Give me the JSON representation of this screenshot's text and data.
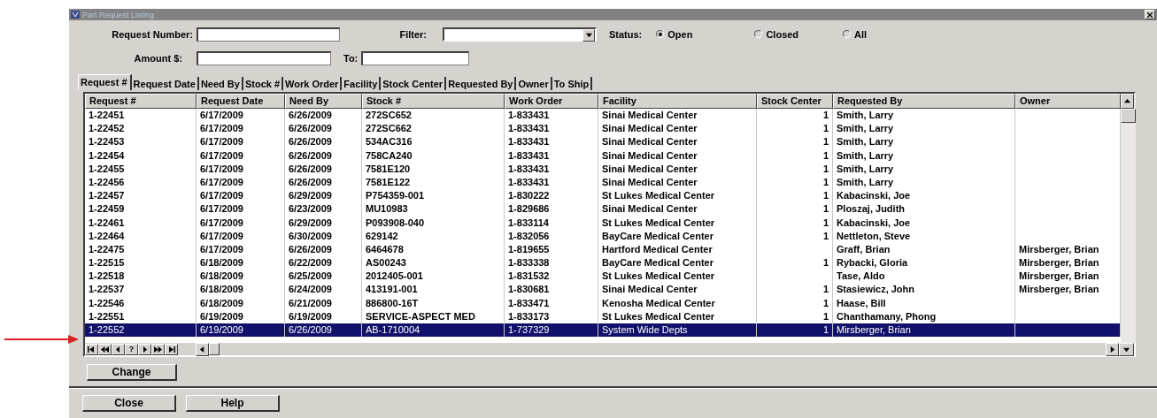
{
  "window": {
    "title": "Part Request Listing"
  },
  "filters": {
    "request_number_label": "Request Number:",
    "filter_label": "Filter:",
    "status_label": "Status:",
    "amount_label": "Amount $:",
    "to_label": "To:"
  },
  "status_options": [
    {
      "label": "Open",
      "selected": true
    },
    {
      "label": "Closed",
      "selected": false
    },
    {
      "label": "All",
      "selected": false
    }
  ],
  "tabs": [
    {
      "label": "Request #",
      "selected": true
    },
    {
      "label": "Request Date",
      "selected": false
    },
    {
      "label": "Need By",
      "selected": false
    },
    {
      "label": "Stock #",
      "selected": false
    },
    {
      "label": "Work Order",
      "selected": false
    },
    {
      "label": "Facility",
      "selected": false
    },
    {
      "label": "Stock Center",
      "selected": false
    },
    {
      "label": "Requested By",
      "selected": false
    },
    {
      "label": "Owner",
      "selected": false
    },
    {
      "label": "To Ship",
      "selected": false
    }
  ],
  "table": {
    "columns": [
      "Request #",
      "Request Date",
      "Need By",
      "Stock #",
      "Work Order",
      "Facility",
      "Stock Center",
      "Requested By",
      "Owner"
    ],
    "rows": [
      {
        "request": "1-22451",
        "request_date": "6/17/2009",
        "need_by": "6/26/2009",
        "stock": "272SC652",
        "work_order": "1-833431",
        "facility": "Sinai Medical Center",
        "stock_center": "1",
        "requested_by": "Smith, Larry",
        "selected": false
      },
      {
        "request": "1-22452",
        "request_date": "6/17/2009",
        "need_by": "6/26/2009",
        "stock": "272SC662",
        "work_order": "1-833431",
        "facility": "Sinai Medical Center",
        "stock_center": "1",
        "requested_by": "Smith, Larry",
        "selected": false
      },
      {
        "request": "1-22453",
        "request_date": "6/17/2009",
        "need_by": "6/26/2009",
        "stock": "534AC316",
        "work_order": "1-833431",
        "facility": "Sinai Medical Center",
        "stock_center": "1",
        "requested_by": "Smith, Larry",
        "selected": false
      },
      {
        "request": "1-22454",
        "request_date": "6/17/2009",
        "need_by": "6/26/2009",
        "stock": "758CA240",
        "work_order": "1-833431",
        "facility": "Sinai Medical Center",
        "stock_center": "1",
        "requested_by": "Smith, Larry",
        "selected": false
      },
      {
        "request": "1-22455",
        "request_date": "6/17/2009",
        "need_by": "6/26/2009",
        "stock": "7581E120",
        "work_order": "1-833431",
        "facility": "Sinai Medical Center",
        "stock_center": "1",
        "requested_by": "Smith, Larry",
        "selected": false
      },
      {
        "request": "1-22456",
        "request_date": "6/17/2009",
        "need_by": "6/26/2009",
        "stock": "7581E122",
        "work_order": "1-833431",
        "facility": "Sinai Medical Center",
        "stock_center": "1",
        "requested_by": "Smith, Larry",
        "selected": false
      },
      {
        "request": "1-22457",
        "request_date": "6/17/2009",
        "need_by": "6/29/2009",
        "stock": "P754359-001",
        "work_order": "1-830222",
        "facility": "St Lukes Medical Center",
        "stock_center": "1",
        "requested_by": "Kabacinski, Joe",
        "selected": false
      },
      {
        "request": "1-22459",
        "request_date": "6/17/2009",
        "need_by": "6/23/2009",
        "stock": "MU10983",
        "work_order": "1-829686",
        "facility": "Sinai Medical Center",
        "stock_center": "1",
        "requested_by": "Ploszaj, Judith",
        "selected": false
      },
      {
        "request": "1-22461",
        "request_date": "6/17/2009",
        "need_by": "6/29/2009",
        "stock": "P093908-040",
        "work_order": "1-833114",
        "facility": "St Lukes Medical Center",
        "stock_center": "1",
        "requested_by": "Kabacinski, Joe",
        "selected": false
      },
      {
        "request": "1-22464",
        "request_date": "6/17/2009",
        "need_by": "6/30/2009",
        "stock": "629142",
        "work_order": "1-832056",
        "facility": "BayCare Medical Center",
        "stock_center": "1",
        "requested_by": "Nettleton, Steve",
        "selected": false
      },
      {
        "request": "1-22475",
        "request_date": "6/17/2009",
        "need_by": "6/26/2009",
        "stock": "6464678",
        "work_order": "1-819655",
        "facility": "Hartford Medical Center",
        "requested_by": "Graff, Brian",
        "owner": "Mirsberger, Brian",
        "selected": false
      },
      {
        "request": "1-22515",
        "request_date": "6/18/2009",
        "need_by": "6/22/2009",
        "stock": "AS00243",
        "work_order": "1-833338",
        "facility": "BayCare Medical Center",
        "stock_center": "1",
        "requested_by": "Rybacki, Gloria",
        "owner": "Mirsberger, Brian",
        "selected": false
      },
      {
        "request": "1-22518",
        "request_date": "6/18/2009",
        "need_by": "6/25/2009",
        "stock": "2012405-001",
        "work_order": "1-831532",
        "facility": "St Lukes Medical Center",
        "requested_by": "Tase, Aldo",
        "owner": "Mirsberger, Brian",
        "selected": false
      },
      {
        "request": "1-22537",
        "request_date": "6/18/2009",
        "need_by": "6/24/2009",
        "stock": "413191-001",
        "work_order": "1-830681",
        "facility": "Sinai Medical Center",
        "stock_center": "1",
        "requested_by": "Stasiewicz, John",
        "owner": "Mirsberger, Brian",
        "selected": false
      },
      {
        "request": "1-22546",
        "request_date": "6/18/2009",
        "need_by": "6/21/2009",
        "stock": "886800-16T",
        "work_order": "1-833471",
        "facility": "Kenosha Medical Center",
        "stock_center": "1",
        "requested_by": "Haase, Bill",
        "selected": false
      },
      {
        "request": "1-22551",
        "request_date": "6/19/2009",
        "need_by": "6/19/2009",
        "stock": "SERVICE-ASPECT MED",
        "work_order": "1-833173",
        "facility": "St Lukes Medical Center",
        "stock_center": "1",
        "requested_by": "Chanthamany, Phong",
        "selected": false
      },
      {
        "request": "1-22552",
        "request_date": "6/19/2009",
        "need_by": "6/26/2009",
        "stock": "AB-1710004",
        "work_order": "1-737329",
        "facility": "System Wide Depts",
        "stock_center": "1",
        "requested_by": "Mirsberger, Brian",
        "selected": true
      }
    ]
  },
  "navigator": {
    "record_label": "?"
  },
  "buttons": {
    "change": "Change",
    "close": "Close",
    "help": "Help"
  }
}
